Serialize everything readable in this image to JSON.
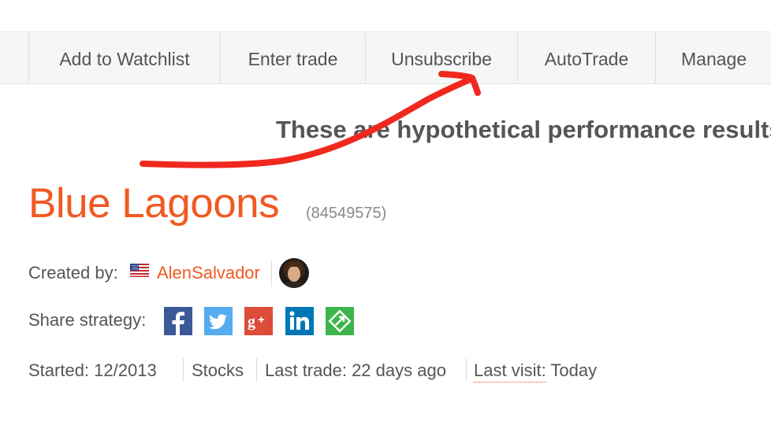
{
  "toolbar": {
    "buttons": [
      {
        "label": "Add to Watchlist"
      },
      {
        "label": "Enter trade"
      },
      {
        "label": "Unsubscribe"
      },
      {
        "label": "AutoTrade"
      },
      {
        "label": "Manage"
      }
    ]
  },
  "disclaimer": "These are hypothetical performance results",
  "strategy": {
    "title": "Blue Lagoons",
    "id": "(84549575)"
  },
  "creator": {
    "label": "Created by:",
    "name": "AlenSalvador",
    "flag_icon": "us-flag-icon"
  },
  "share": {
    "label": "Share strategy:",
    "networks": [
      {
        "icon": "facebook-icon",
        "color": "#3b5998"
      },
      {
        "icon": "twitter-icon",
        "color": "#55acee"
      },
      {
        "icon": "google-plus-icon",
        "color": "#dd4b39"
      },
      {
        "icon": "linkedin-icon",
        "color": "#0077b5"
      },
      {
        "icon": "link-icon",
        "color": "#3cb54a"
      }
    ]
  },
  "stats": {
    "started": "Started: 12/2013",
    "market": "Stocks",
    "last_trade": "Last trade: 22 days ago",
    "last_visit_label": "Last visit:",
    "last_visit_value": "Today"
  },
  "colors": {
    "accent": "#f05a22",
    "annotation_arrow": "#f0281e"
  }
}
